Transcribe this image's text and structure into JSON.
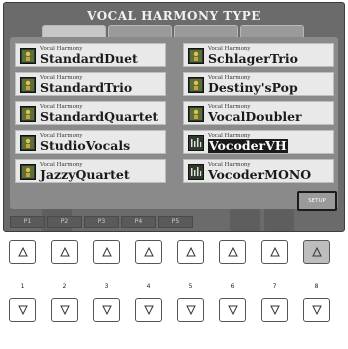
{
  "screen": {
    "title": "VOCAL HARMONY TYPE"
  },
  "items_left": [
    {
      "category": "Vocal Harmony",
      "name": "StandardDuet",
      "icon": "vocal-harmony-icon"
    },
    {
      "category": "Vocal Harmony",
      "name": "StandardTrio",
      "icon": "vocal-harmony-icon"
    },
    {
      "category": "Vocal Harmony",
      "name": "StandardQuartet",
      "icon": "vocal-harmony-icon"
    },
    {
      "category": "Vocal Harmony",
      "name": "StudioVocals",
      "icon": "vocal-harmony-icon"
    },
    {
      "category": "Vocal Harmony",
      "name": "JazzyQuartet",
      "icon": "vocal-harmony-icon"
    }
  ],
  "items_right": [
    {
      "category": "Vocal Harmony",
      "name": "SchlagerTrio",
      "icon": "vocal-harmony-icon"
    },
    {
      "category": "Vocal Harmony",
      "name": "Destiny'sPop",
      "icon": "vocal-harmony-icon"
    },
    {
      "category": "Vocal Harmony",
      "name": "VocalDoubler",
      "icon": "vocal-harmony-icon"
    },
    {
      "category": "Vocal Harmony",
      "name": "VocoderVH",
      "icon": "vocoder-icon",
      "selected": true
    },
    {
      "category": "Vocal Harmony",
      "name": "VocoderMONO",
      "icon": "vocoder-icon"
    }
  ],
  "pages": [
    "P1",
    "P2",
    "P3",
    "P4",
    "P5"
  ],
  "setup_label": "SETUP",
  "button_numbers": [
    "1",
    "2",
    "3",
    "4",
    "5",
    "6",
    "7",
    "8"
  ],
  "active_button": "8"
}
